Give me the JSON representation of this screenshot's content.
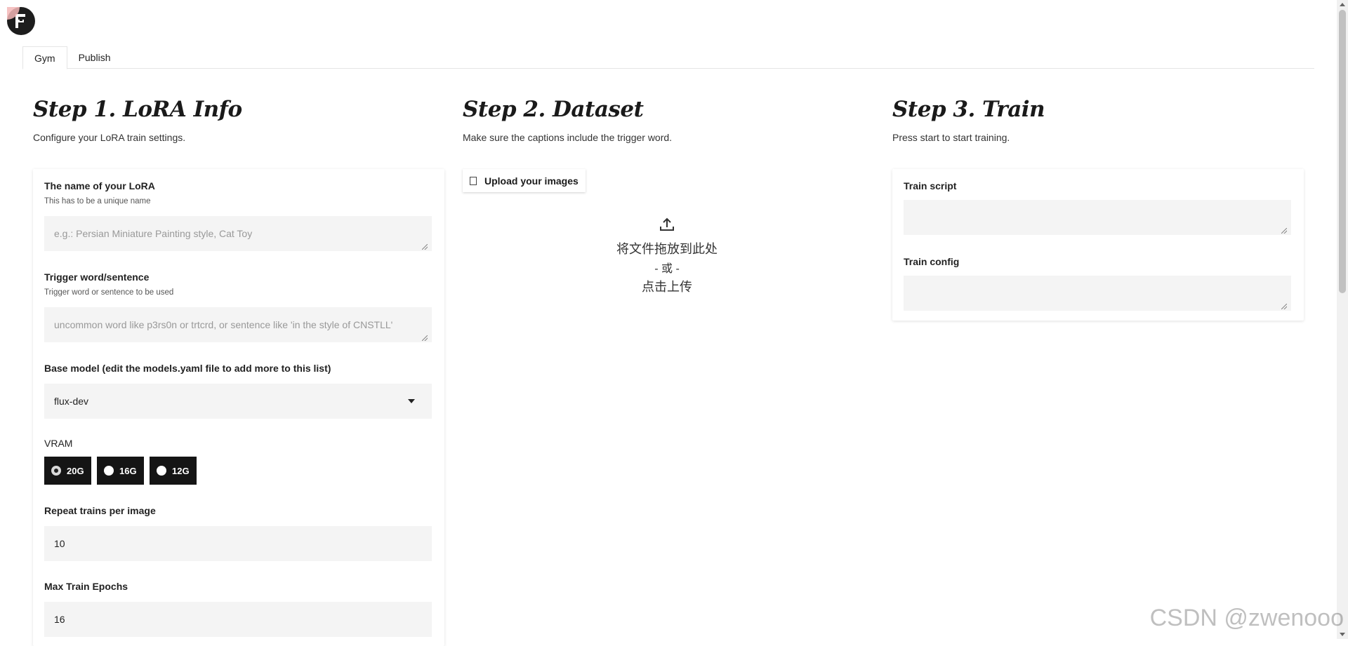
{
  "logo": {
    "icon": "app-logo-icon",
    "text": "F"
  },
  "tabs": [
    {
      "label": "Gym",
      "active": true
    },
    {
      "label": "Publish",
      "active": false
    }
  ],
  "step1": {
    "title": "Step 1. LoRA Info",
    "subtitle": "Configure your LoRA train settings.",
    "lora_name": {
      "label": "The name of your LoRA",
      "help": "This has to be a unique name",
      "placeholder": "e.g.: Persian Miniature Painting style, Cat Toy"
    },
    "trigger": {
      "label": "Trigger word/sentence",
      "help": "Trigger word or sentence to be used",
      "placeholder": "uncommon word like p3rs0n or trtcrd, or sentence like 'in the style of CNSTLL'"
    },
    "base_model": {
      "label": "Base model (edit the models.yaml file to add more to this list)",
      "value": "flux-dev"
    },
    "vram": {
      "label": "VRAM",
      "options": [
        {
          "label": "20G",
          "checked": true
        },
        {
          "label": "16G",
          "checked": false
        },
        {
          "label": "12G",
          "checked": false
        }
      ]
    },
    "repeat": {
      "label": "Repeat trains per image",
      "value": "10"
    },
    "epochs": {
      "label": "Max Train Epochs",
      "value": "16"
    }
  },
  "step2": {
    "title": "Step 2. Dataset",
    "subtitle": "Make sure the captions include the trigger word.",
    "upload_button": "Upload your images",
    "drop_line1": "将文件拖放到此处",
    "drop_line2": "- 或 -",
    "drop_line3": "点击上传"
  },
  "step3": {
    "title": "Step 3. Train",
    "subtitle": "Press start to start training.",
    "train_script_label": "Train script",
    "train_config_label": "Train config"
  },
  "watermark": "CSDN @zwenooo"
}
